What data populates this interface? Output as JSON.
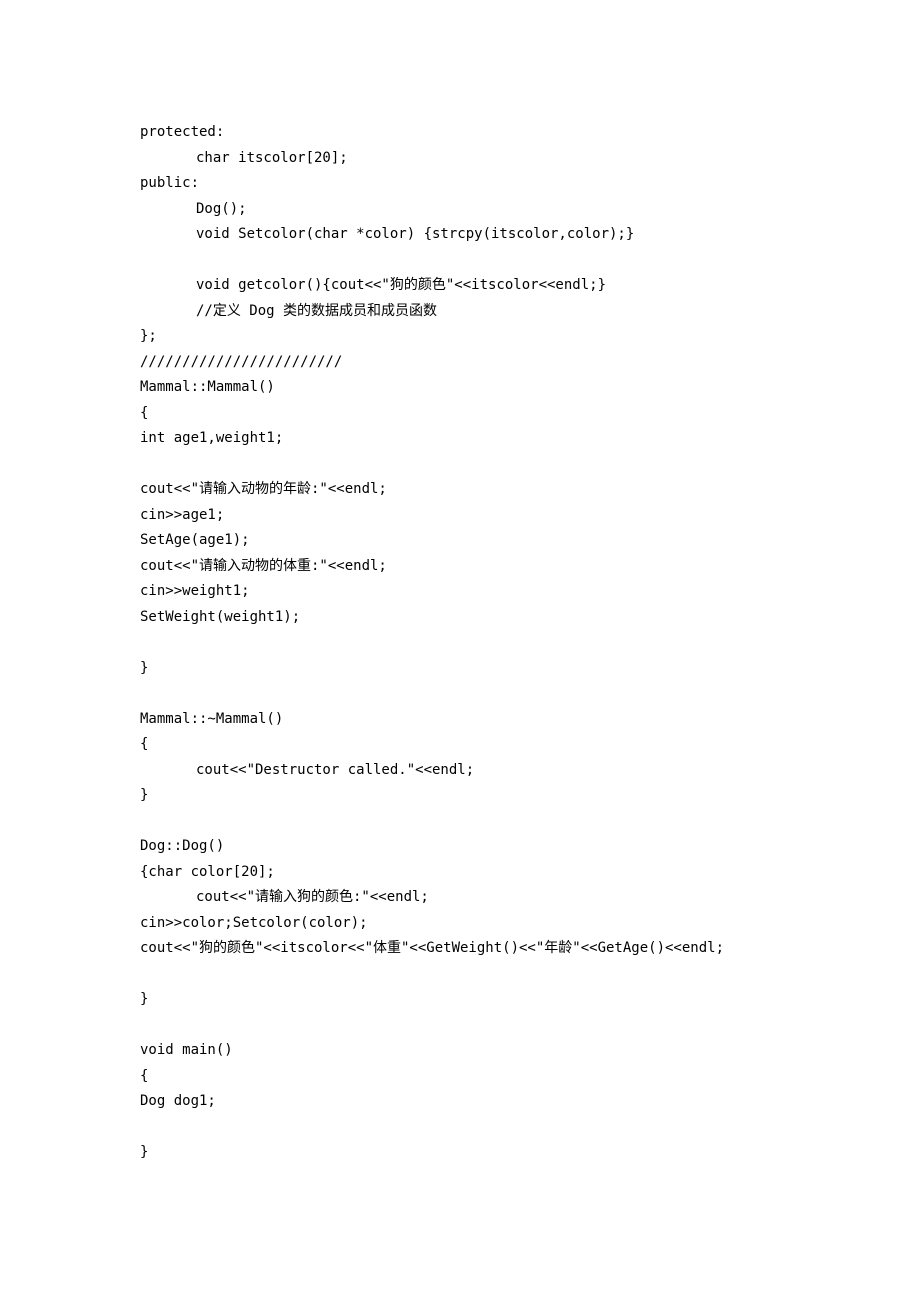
{
  "lines": [
    {
      "text": "protected:",
      "indent": false
    },
    {
      "text": "char itscolor[20];",
      "indent": true
    },
    {
      "text": "public:",
      "indent": false
    },
    {
      "text": "Dog();",
      "indent": true
    },
    {
      "text": "void Setcolor(char *color) {strcpy(itscolor,color);}",
      "indent": true
    },
    {
      "text": "",
      "indent": false
    },
    {
      "text": "void getcolor(){cout<<\"狗的颜色\"<<itscolor<<endl;}",
      "indent": true
    },
    {
      "text": "//定义 Dog 类的数据成员和成员函数",
      "indent": true
    },
    {
      "text": "};",
      "indent": false
    },
    {
      "text": "////////////////////////",
      "indent": false
    },
    {
      "text": "Mammal::Mammal()",
      "indent": false
    },
    {
      "text": "{",
      "indent": false
    },
    {
      "text": "int age1,weight1;",
      "indent": false
    },
    {
      "text": "",
      "indent": false
    },
    {
      "text": "cout<<\"请输入动物的年龄:\"<<endl;",
      "indent": false
    },
    {
      "text": "cin>>age1;",
      "indent": false
    },
    {
      "text": "SetAge(age1);",
      "indent": false
    },
    {
      "text": "cout<<\"请输入动物的体重:\"<<endl;",
      "indent": false
    },
    {
      "text": "cin>>weight1;",
      "indent": false
    },
    {
      "text": "SetWeight(weight1);",
      "indent": false
    },
    {
      "text": "",
      "indent": false
    },
    {
      "text": "}",
      "indent": false
    },
    {
      "text": "",
      "indent": false
    },
    {
      "text": "Mammal::~Mammal()",
      "indent": false
    },
    {
      "text": "{",
      "indent": false
    },
    {
      "text": "cout<<\"Destructor called.\"<<endl;",
      "indent": true
    },
    {
      "text": "}",
      "indent": false
    },
    {
      "text": "",
      "indent": false
    },
    {
      "text": "Dog::Dog()",
      "indent": false
    },
    {
      "text": "{char color[20];",
      "indent": false
    },
    {
      "text": "cout<<\"请输入狗的颜色:\"<<endl;",
      "indent": true
    },
    {
      "text": "cin>>color;Setcolor(color);",
      "indent": false
    },
    {
      "text": "cout<<\"狗的颜色\"<<itscolor<<\"体重\"<<GetWeight()<<\"年龄\"<<GetAge()<<endl;",
      "indent": false
    },
    {
      "text": "",
      "indent": false
    },
    {
      "text": "}",
      "indent": false
    },
    {
      "text": "",
      "indent": false
    },
    {
      "text": "void main()",
      "indent": false
    },
    {
      "text": "{",
      "indent": false
    },
    {
      "text": "Dog dog1;",
      "indent": false
    },
    {
      "text": "",
      "indent": false
    },
    {
      "text": "}",
      "indent": false
    }
  ]
}
